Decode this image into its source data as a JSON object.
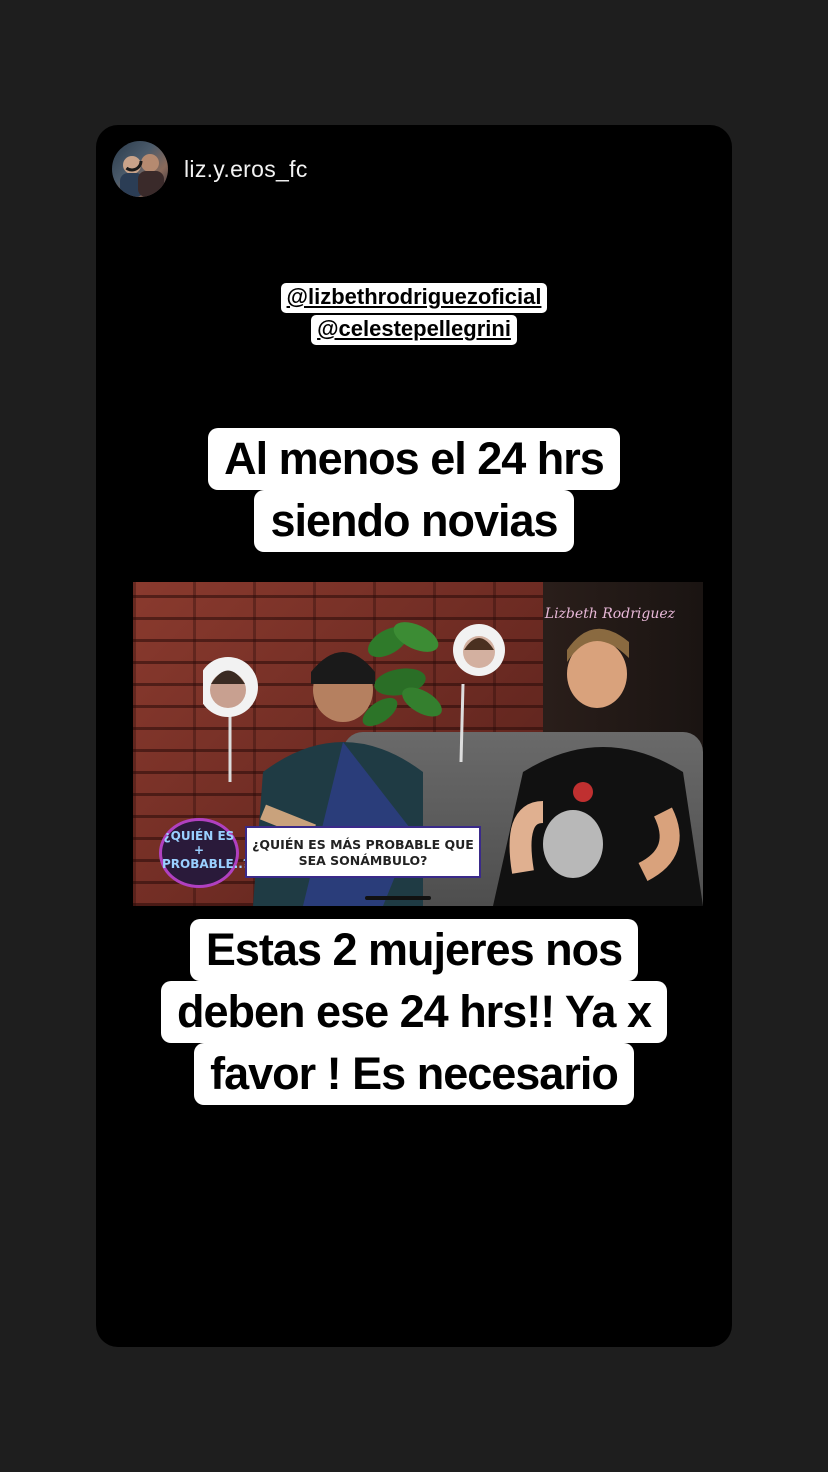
{
  "header": {
    "username": "liz.y.eros_fc",
    "avatar_icon": "profile-avatar-icon"
  },
  "mentions": [
    "@lizbethrodriguezoficial",
    "@celestepellegrini"
  ],
  "caption_top": {
    "lines": [
      "Al menos el 24 hrs",
      "siendo novias"
    ]
  },
  "media": {
    "question_text": "¿QUIÉN ES MÁS PROBABLE QUE SEA SONÁMBULO?",
    "logo_text": "¿QUIÉN ES + PROBABLE..?",
    "watermark": "Lizbeth Rodriguez"
  },
  "caption_bottom": {
    "lines": [
      "Estas 2 mujeres nos",
      "deben ese 24 hrs!! Ya x",
      "favor ! Es necesario"
    ]
  },
  "colors": {
    "background": "#1e1e1e",
    "card": "#000000",
    "caption_bg": "#ffffff",
    "caption_text": "#000000"
  }
}
